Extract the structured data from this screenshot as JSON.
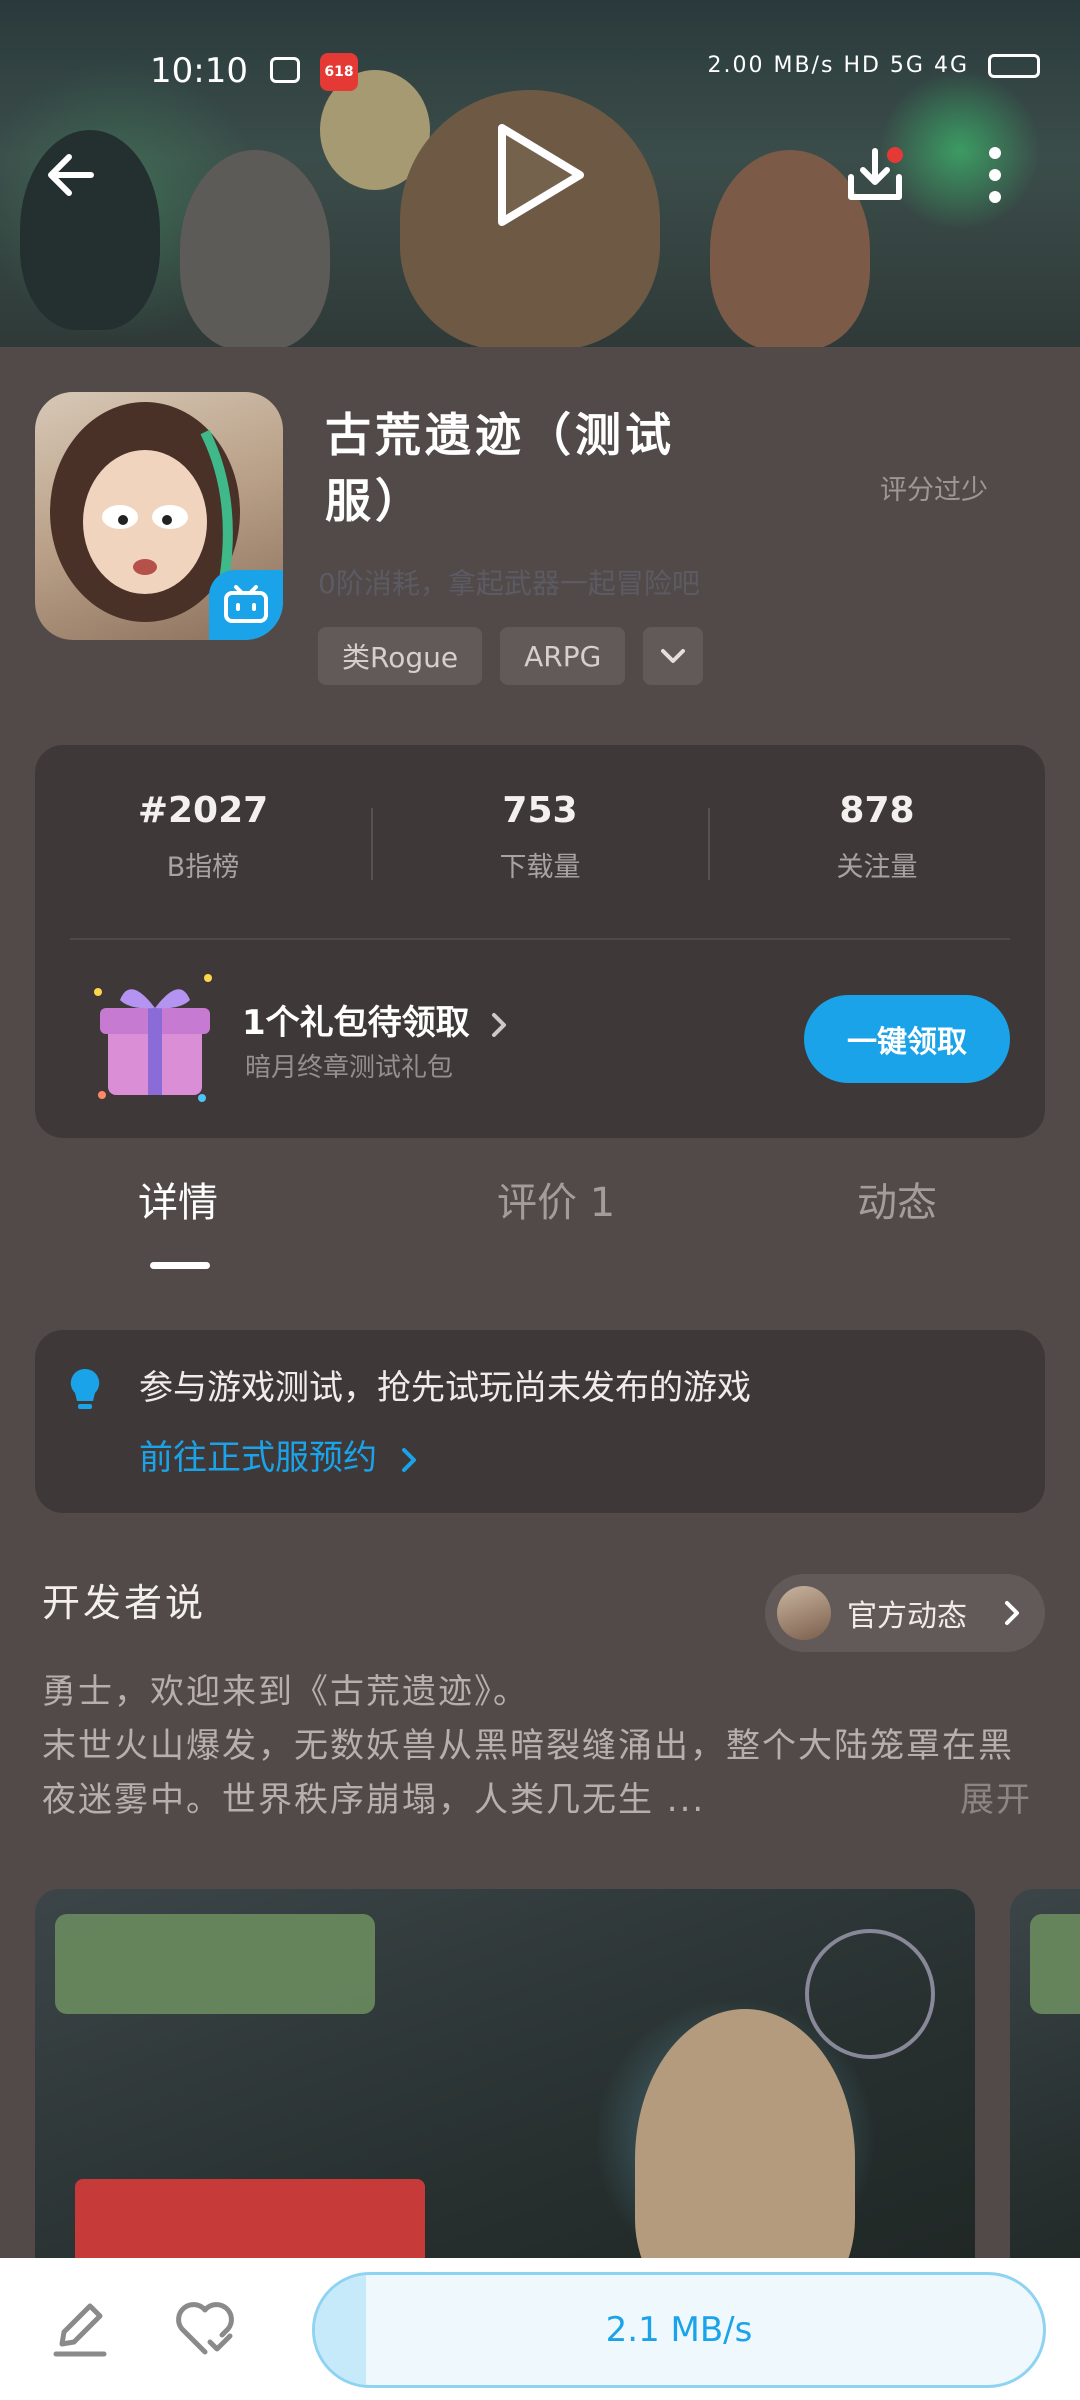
{
  "status_bar": {
    "time": "10:10",
    "promo_badge": "618",
    "net_speed": "2.00 MB/s",
    "signal_text": "HD 5G 4G"
  },
  "game": {
    "title": "古荒遗迹（测试服）",
    "rating_note": "评分过少",
    "subtitle": "0阶消耗，拿起武器一起冒险吧",
    "tags": [
      "类Rogue",
      "ARPG"
    ]
  },
  "stats": [
    {
      "value": "#2027",
      "label": "B指榜"
    },
    {
      "value": "753",
      "label": "下载量"
    },
    {
      "value": "878",
      "label": "关注量"
    }
  ],
  "gift": {
    "title": "1个礼包待领取",
    "subtitle": "暗月终章测试礼包",
    "button": "一键领取"
  },
  "tabs": [
    {
      "label": "详情",
      "active": true
    },
    {
      "label": "评价 1",
      "active": false
    },
    {
      "label": "动态",
      "active": false
    }
  ],
  "notice": {
    "text": "参与游戏测试，抢先试玩尚未发布的游戏",
    "link": "前往正式服预约"
  },
  "developer": {
    "section_title": "开发者说",
    "official_label": "官方动态",
    "description": "勇士，欢迎来到《古荒遗迹》。\n末世火山爆发，无数妖兽从黑暗裂缝涌出，整个大陆笼罩在黑夜迷雾中。世界秩序崩塌，人类几无生 ...",
    "expand": "展开"
  },
  "download": {
    "speed": "2.1 MB/s",
    "progress": 0.07
  },
  "colors": {
    "accent": "#1aa3e8",
    "background": "#514a49",
    "card": "#3e3938"
  },
  "icons": [
    "back-arrow-icon",
    "play-icon",
    "download-icon",
    "more-vertical-icon",
    "bilibili-icon",
    "gift-icon",
    "bulb-icon",
    "chevron-right-icon",
    "chevron-down-icon",
    "edit-icon",
    "heart-icon"
  ]
}
